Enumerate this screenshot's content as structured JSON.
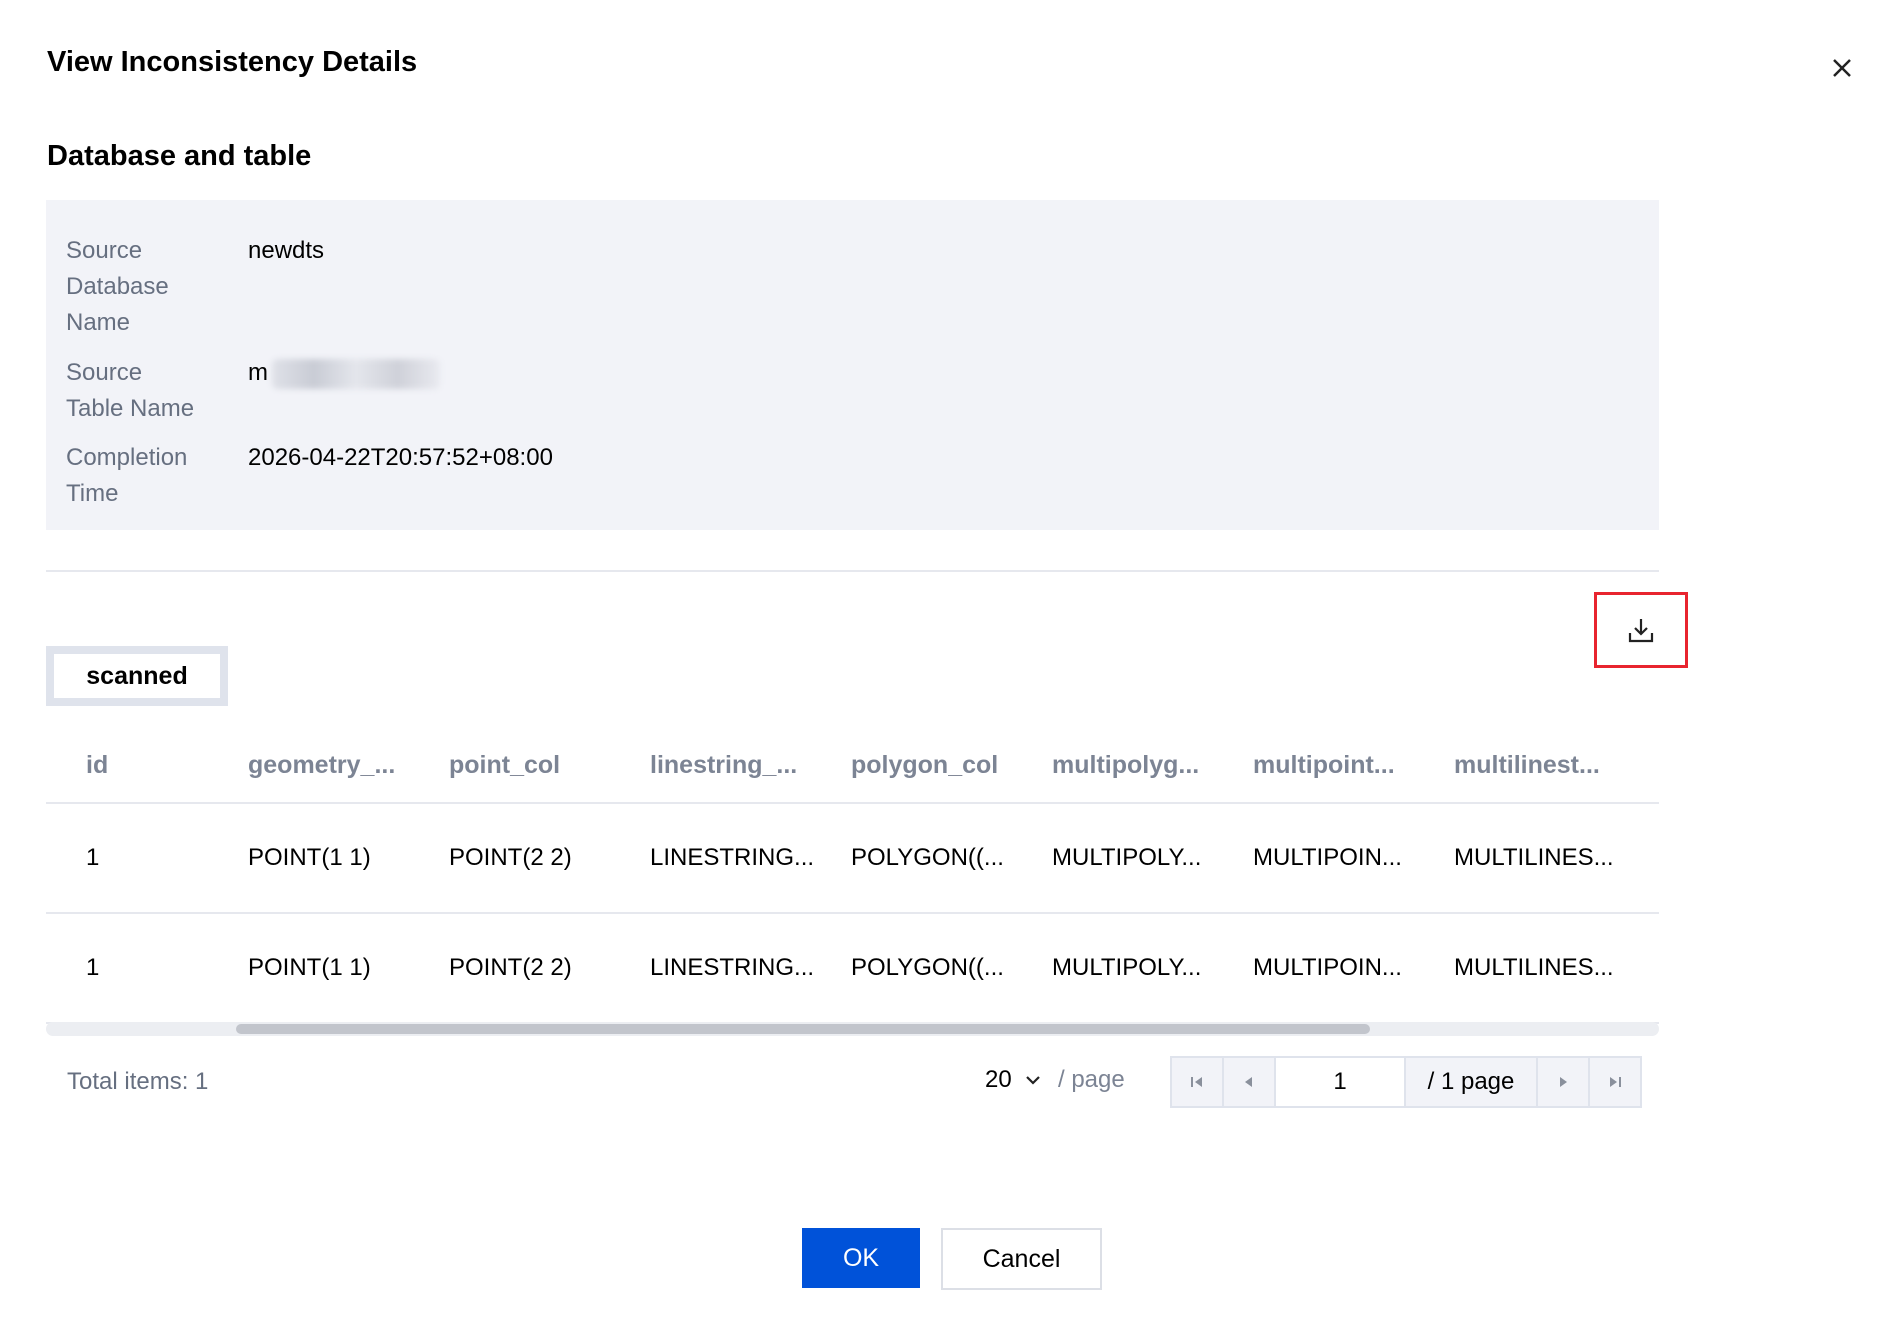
{
  "dialog": {
    "title": "View Inconsistency Details",
    "close_icon": "close-icon"
  },
  "section": {
    "title": "Database and table"
  },
  "info": [
    {
      "label_lines": [
        "Source",
        "Database",
        "Name"
      ],
      "value": "newdts"
    },
    {
      "label_lines": [
        "Source",
        "Table Name"
      ],
      "value": "m"
    },
    {
      "label_lines": [
        "Completion",
        "Time"
      ],
      "value": "2026-04-22T20:57:52+08:00"
    }
  ],
  "toolbar": {
    "download_icon": "download-icon",
    "highlight_color": "#e8242f"
  },
  "tabs": [
    {
      "label": "scanned"
    }
  ],
  "table": {
    "columns": [
      "id",
      "geometry_...",
      "point_col",
      "linestring_...",
      "polygon_col",
      "multipolyg...",
      "multipoint...",
      "multilinest..."
    ],
    "rows": [
      [
        "1",
        "POINT(1 1)",
        "POINT(2 2)",
        "LINESTRING...",
        "POLYGON((...",
        "MULTIPOLY...",
        "MULTIPOIN...",
        "MULTILINES..."
      ],
      [
        "1",
        "POINT(1 1)",
        "POINT(2 2)",
        "LINESTRING...",
        "POLYGON((...",
        "MULTIPOLY...",
        "MULTIPOIN...",
        "MULTILINES..."
      ]
    ]
  },
  "pagination": {
    "total_label": "Total items: 1",
    "page_size": "20",
    "per_page_label": "/ page",
    "current_page": "1",
    "total_pages_label": "/ 1 page"
  },
  "footer": {
    "ok_label": "OK",
    "cancel_label": "Cancel",
    "primary_color": "#0052d9"
  }
}
